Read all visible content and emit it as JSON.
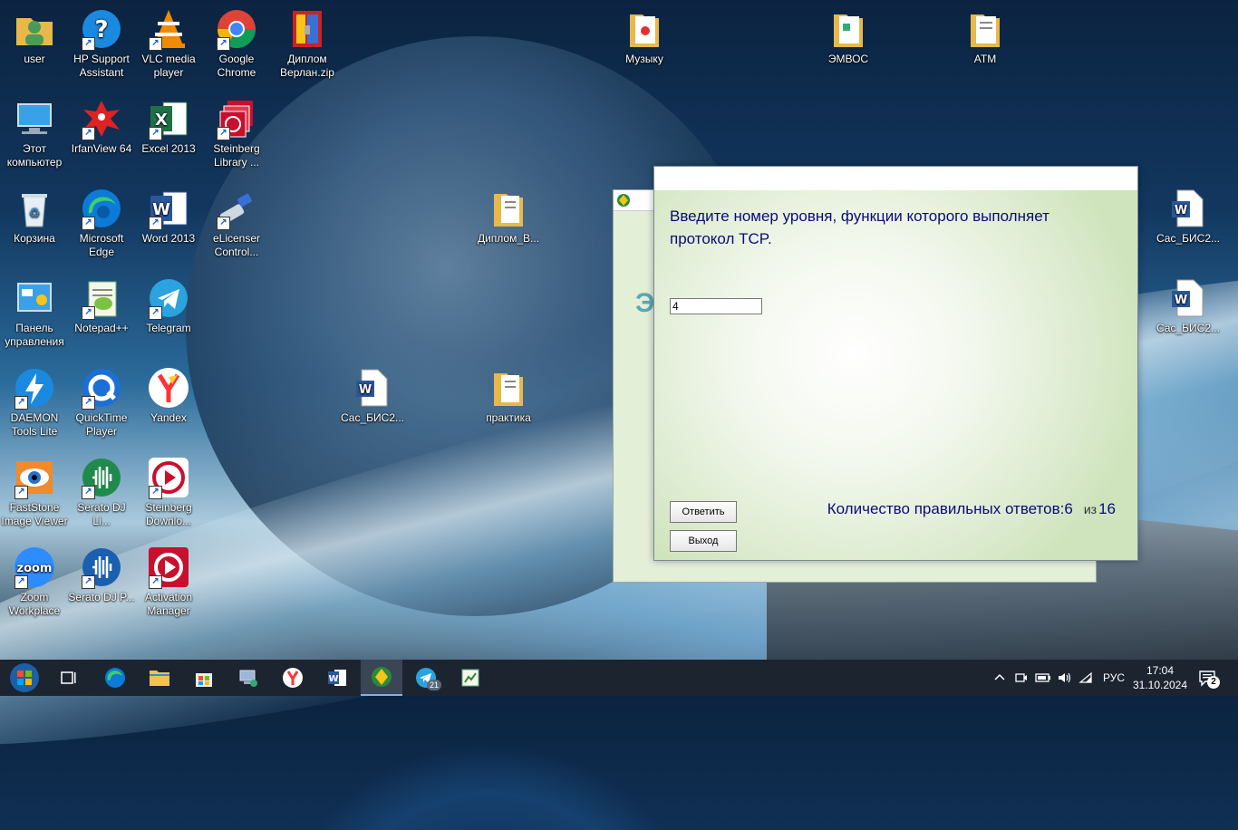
{
  "desktop": {
    "icons": [
      {
        "label": "user",
        "icon": "user-folder-icon"
      },
      {
        "label": "HP Support Assistant",
        "icon": "help-icon"
      },
      {
        "label": "VLC media player",
        "icon": "vlc-icon"
      },
      {
        "label": "Google Chrome",
        "icon": "chrome-icon"
      },
      {
        "label": "Диплом Верлан.zip",
        "icon": "archive-icon"
      },
      {
        "label": "Музыку",
        "icon": "folder-icon"
      },
      {
        "label": "ЭМВОС",
        "icon": "folder-icon"
      },
      {
        "label": "АТМ",
        "icon": "folder-icon"
      },
      {
        "label": "Этот компьютер",
        "icon": "computer-icon"
      },
      {
        "label": "IrfanView 64",
        "icon": "irfanview-icon"
      },
      {
        "label": "Excel 2013",
        "icon": "excel-icon"
      },
      {
        "label": "Steinberg Library ...",
        "icon": "steinberg-library-icon"
      },
      {
        "label": "Корзина",
        "icon": "recycle-bin-icon"
      },
      {
        "label": "Microsoft Edge",
        "icon": "edge-icon"
      },
      {
        "label": "Word 2013",
        "icon": "word-icon"
      },
      {
        "label": "eLicenser Control...",
        "icon": "elicenser-icon"
      },
      {
        "label": "Диплом_В...",
        "icon": "folder-icon"
      },
      {
        "label": "Сас_БИС2...",
        "icon": "word-doc-icon"
      },
      {
        "label": "Панель управления",
        "icon": "control-panel-icon"
      },
      {
        "label": "Notepad++",
        "icon": "notepad-plus-icon"
      },
      {
        "label": "Telegram",
        "icon": "telegram-icon"
      },
      {
        "label": "Сас_БИС2...",
        "icon": "word-doc-icon"
      },
      {
        "label": "DAEMON Tools Lite",
        "icon": "daemon-tools-icon"
      },
      {
        "label": "QuickTime Player",
        "icon": "quicktime-icon"
      },
      {
        "label": "Yandex",
        "icon": "yandex-icon"
      },
      {
        "label": "Сас_БИС2...",
        "icon": "word-doc-icon"
      },
      {
        "label": "практика",
        "icon": "folder-icon"
      },
      {
        "label": "FastStone Image Viewer",
        "icon": "faststone-icon"
      },
      {
        "label": "Serato DJ Li...",
        "icon": "serato-icon"
      },
      {
        "label": "Steinberg Downlo...",
        "icon": "steinberg-download-icon"
      },
      {
        "label": "Zoom Workplace",
        "icon": "zoom-icon"
      },
      {
        "label": "Serato DJ P...",
        "icon": "serato-icon"
      },
      {
        "label": "Activation Manager",
        "icon": "activation-manager-icon"
      }
    ]
  },
  "background_window": {
    "partial_text": "Э"
  },
  "dialog": {
    "question": "Введите номер уровня, функции которого выполняет протокол TCP.",
    "answer_value": "4",
    "answer_button": "Ответить",
    "exit_button": "Выход",
    "score_label": "Количество правильных ответов:",
    "score_correct": "6",
    "score_of": "из",
    "score_total": "16"
  },
  "taskbar": {
    "pinned": [
      {
        "name": "start-button"
      },
      {
        "name": "task-view-button"
      },
      {
        "name": "edge-taskbar"
      },
      {
        "name": "explorer-taskbar"
      },
      {
        "name": "store-taskbar"
      },
      {
        "name": "network-app-taskbar"
      },
      {
        "name": "yandex-taskbar"
      },
      {
        "name": "word-taskbar"
      },
      {
        "name": "tester-app-taskbar"
      },
      {
        "name": "telegram-taskbar"
      },
      {
        "name": "editor-taskbar"
      }
    ],
    "telegram_badge": "21",
    "language": "РУС",
    "time": "17:04",
    "date": "31.10.2024",
    "notifications": "2"
  },
  "colors": {
    "dialog_text": "#0b0b7a",
    "taskbar_bg": "#1c2430"
  }
}
